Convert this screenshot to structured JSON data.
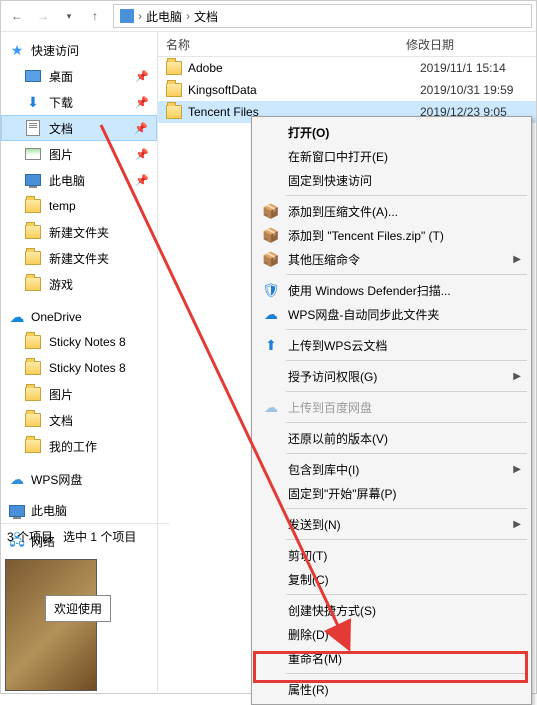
{
  "breadcrumb": {
    "root": "此电脑",
    "folder": "文档"
  },
  "sidebar": {
    "quick": "快速访问",
    "items": [
      {
        "label": "桌面",
        "pin": true
      },
      {
        "label": "下载",
        "pin": true
      },
      {
        "label": "文档",
        "pin": true,
        "sel": true
      },
      {
        "label": "图片",
        "pin": true
      },
      {
        "label": "此电脑",
        "pin": true
      },
      {
        "label": "temp",
        "pin": false
      },
      {
        "label": "新建文件夹",
        "pin": false
      },
      {
        "label": "新建文件夹",
        "pin": false
      },
      {
        "label": "游戏",
        "pin": false
      }
    ],
    "onedrive": "OneDrive",
    "od_items": [
      {
        "label": "Sticky Notes 8"
      },
      {
        "label": "Sticky Notes 8"
      },
      {
        "label": "图片"
      },
      {
        "label": "文档"
      },
      {
        "label": "我的工作"
      }
    ],
    "wps": "WPS网盘",
    "thispc": "此电脑",
    "network": "网络"
  },
  "columns": {
    "name": "名称",
    "date": "修改日期"
  },
  "files": [
    {
      "name": "Adobe",
      "date": "2019/11/1 15:14"
    },
    {
      "name": "KingsoftData",
      "date": "2019/10/31 19:59"
    },
    {
      "name": "Tencent Files",
      "date": "2019/12/23 9:05",
      "sel": true
    }
  ],
  "status": {
    "count": "3 个项目",
    "selected": "选中 1 个项目"
  },
  "ctx": {
    "open": "打开(O)",
    "newwin": "在新窗口中打开(E)",
    "pin_quick": "固定到快速访问",
    "add_zip": "添加到压缩文件(A)...",
    "add_zip_named": "添加到 \"Tencent Files.zip\" (T)",
    "other_zip": "其他压缩命令",
    "defender": "使用 Windows Defender扫描...",
    "wps_sync": "WPS网盘-自动同步此文件夹",
    "wps_upload": "上传到WPS云文档",
    "grant": "授予访问权限(G)",
    "baidu": "上传到百度网盘",
    "restore": "还原以前的版本(V)",
    "include": "包含到库中(I)",
    "pin_start": "固定到\"开始\"屏幕(P)",
    "sendto": "发送到(N)",
    "cut": "剪切(T)",
    "copy": "复制(C)",
    "shortcut": "创建快捷方式(S)",
    "del": "删除(D)",
    "rename": "重命名(M)",
    "props": "属性(R)"
  },
  "bubble": "欢迎使用"
}
